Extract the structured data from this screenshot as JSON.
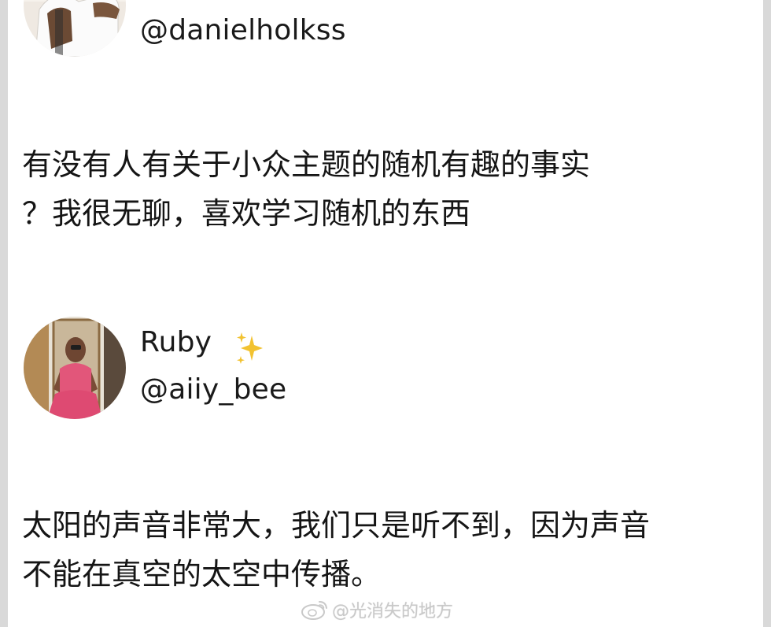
{
  "posts": [
    {
      "handle": "@danielholkss",
      "avatar_icon": "person-photo-avatar",
      "text_lines": [
        "有没有人有关于小众主题的随机有趣的事实",
        "？我很无聊，喜欢学习随机的东西"
      ]
    },
    {
      "display_name": "Ruby",
      "name_decoration_icon": "sparkles-icon",
      "handle": "@aiiy_bee",
      "avatar_icon": "person-photo-avatar",
      "text_lines": [
        "太阳的声音非常大，我们只是听不到，因为声音",
        "不能在真空的太空中传播。"
      ]
    }
  ],
  "watermark": {
    "icon": "weibo-logo-icon",
    "text": "@光消失的地方"
  },
  "colors": {
    "background": "#ffffff",
    "edge": "#d9d9d9",
    "text": "#151515",
    "sparkle": "#f2c230",
    "watermark": "#c9c9c9"
  }
}
